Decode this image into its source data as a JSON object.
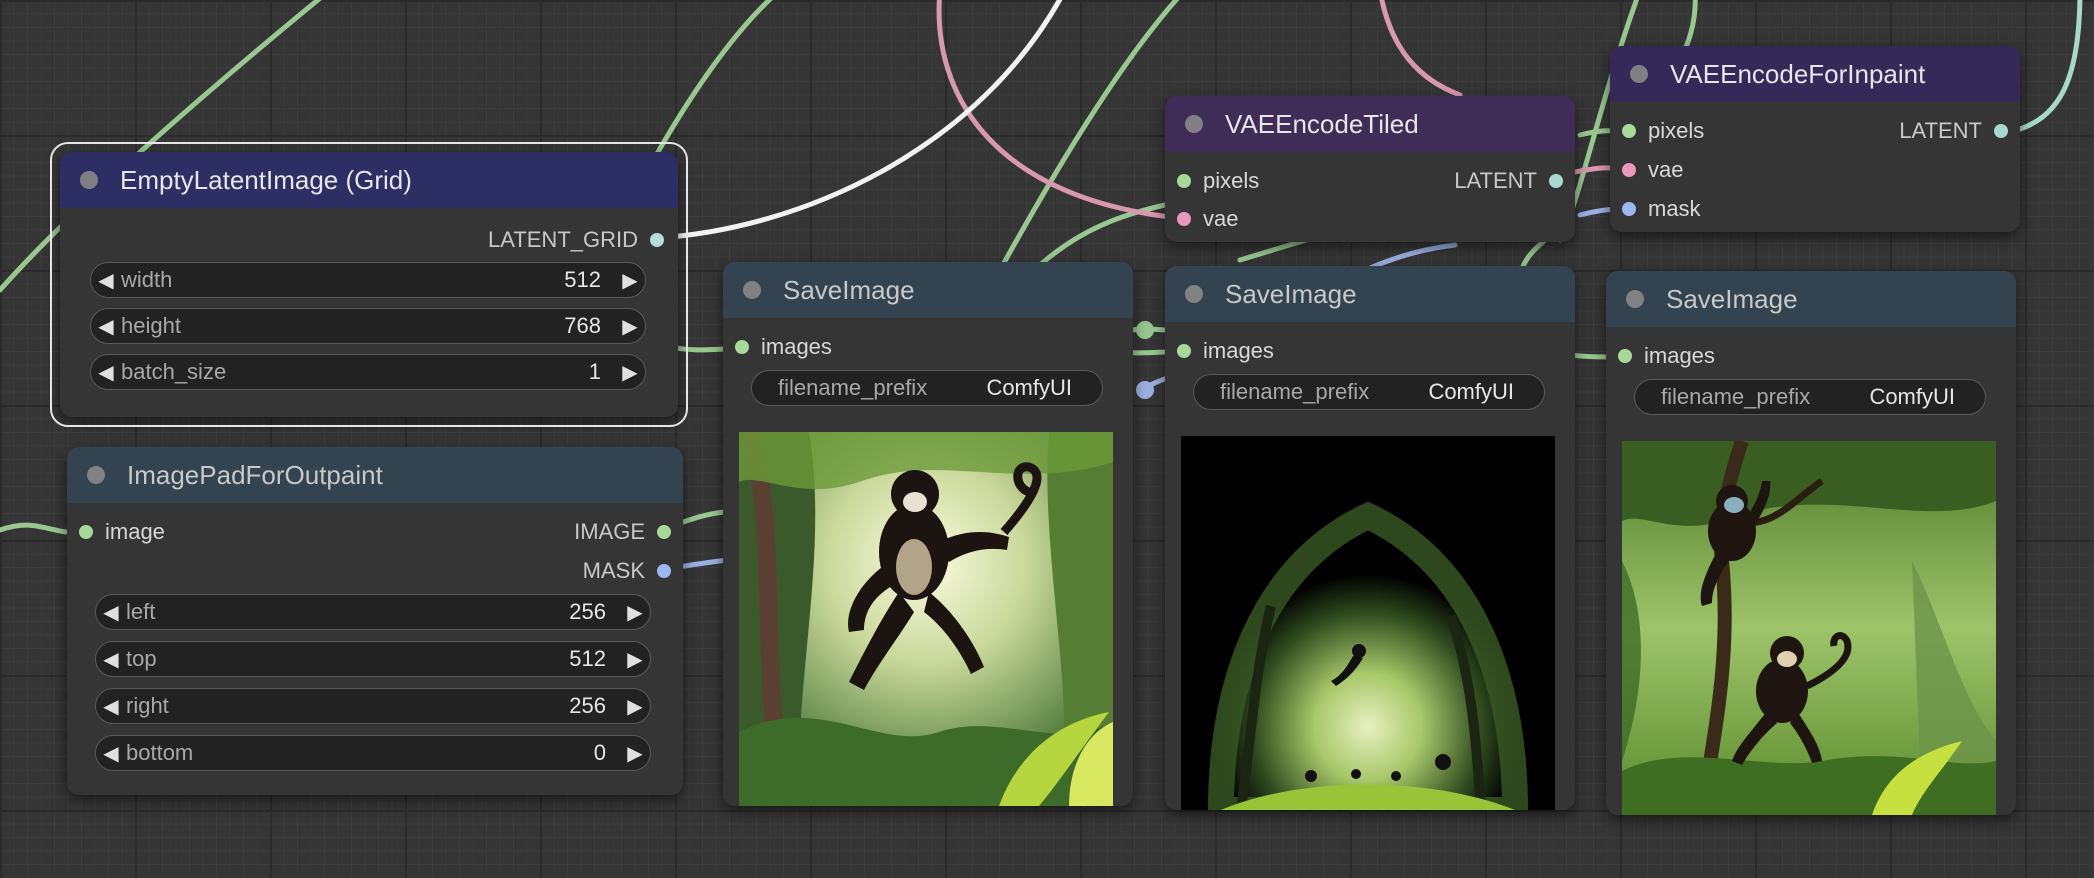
{
  "nodes": {
    "empty_latent": {
      "title": "EmptyLatentImage (Grid)",
      "output": "LATENT_GRID",
      "widgets": [
        {
          "label": "width",
          "value": "512"
        },
        {
          "label": "height",
          "value": "768"
        },
        {
          "label": "batch_size",
          "value": "1"
        }
      ]
    },
    "pad_outpaint": {
      "title": "ImagePadForOutpaint",
      "input": "image",
      "outputs": [
        "IMAGE",
        "MASK"
      ],
      "widgets": [
        {
          "label": "left",
          "value": "256"
        },
        {
          "label": "top",
          "value": "512"
        },
        {
          "label": "right",
          "value": "256"
        },
        {
          "label": "bottom",
          "value": "0"
        }
      ]
    },
    "save1": {
      "title": "SaveImage",
      "input": "images",
      "prefix_label": "filename_prefix",
      "prefix_value": "ComfyUI"
    },
    "save2": {
      "title": "SaveImage",
      "input": "images",
      "prefix_label": "filename_prefix",
      "prefix_value": "ComfyUI"
    },
    "save3": {
      "title": "SaveImage",
      "input": "images",
      "prefix_label": "filename_prefix",
      "prefix_value": "ComfyUI"
    },
    "vae_tiled": {
      "title": "VAEEncodeTiled",
      "inputs": [
        "pixels",
        "vae"
      ],
      "output": "LATENT"
    },
    "vae_inpaint": {
      "title": "VAEEncodeForInpaint",
      "inputs": [
        "pixels",
        "vae",
        "mask"
      ],
      "output": "LATENT"
    }
  },
  "colors": {
    "image_slot": "#a8d89a",
    "vae_slot": "#e89ab8",
    "mask_slot": "#9cb8f0",
    "latent_slot": "#a8d8d0",
    "latent_grid_slot": "#b8dcdc"
  }
}
